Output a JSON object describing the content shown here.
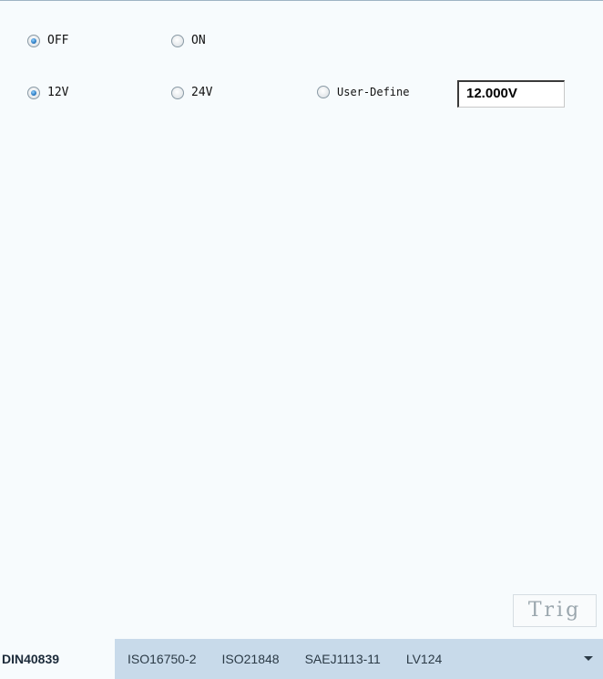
{
  "power": {
    "off_label": "OFF",
    "on_label": "ON",
    "selected": "OFF"
  },
  "voltage": {
    "v12_label": "12V",
    "v24_label": "24V",
    "user_define_label": "User-Define",
    "user_define_value": "12.000V",
    "selected": "12V"
  },
  "trig_label": "Trig",
  "tabs": [
    {
      "label": "DIN40839",
      "active": true
    },
    {
      "label": "ISO16750-2",
      "active": false
    },
    {
      "label": "ISO21848",
      "active": false
    },
    {
      "label": "SAEJ1113-11",
      "active": false
    },
    {
      "label": "LV124",
      "active": false
    }
  ],
  "tab_more_icon": "chevron-down-icon",
  "colors": {
    "background": "#f7fbfd",
    "tabbar": "#c8daea",
    "radio_checked": "#1f6fb8"
  }
}
